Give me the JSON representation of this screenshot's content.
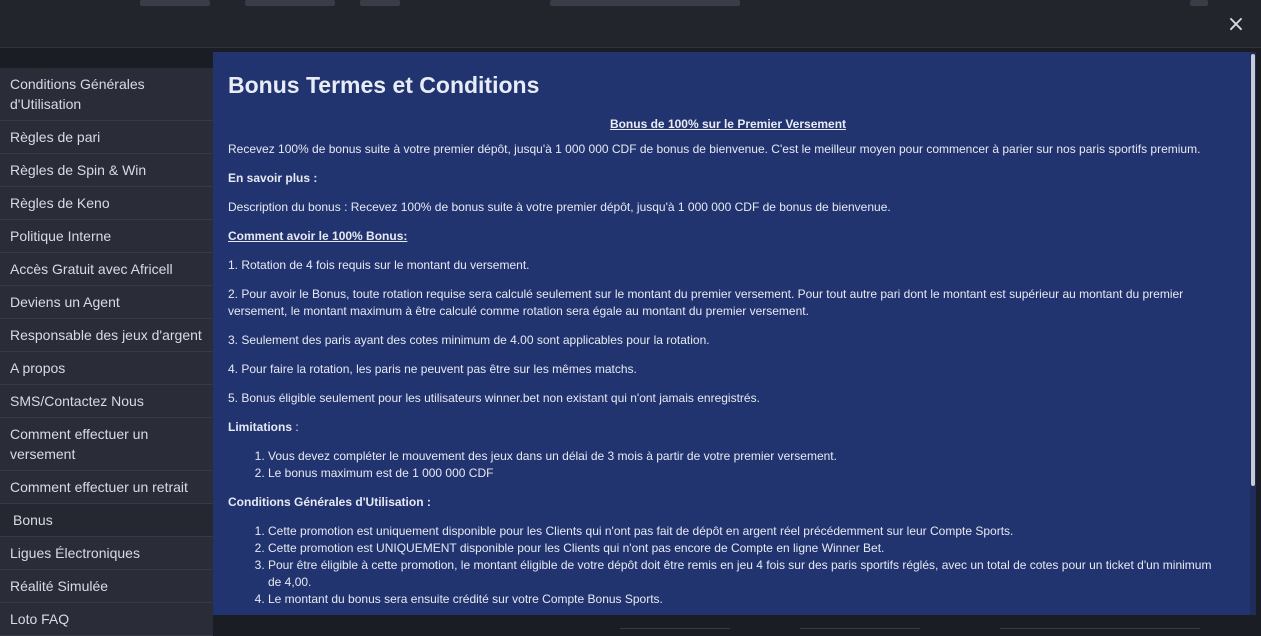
{
  "modal": {
    "close_icon": "×"
  },
  "sidebar": {
    "items": [
      {
        "label": "Conditions Générales d'Utilisation"
      },
      {
        "label": "Règles de pari"
      },
      {
        "label": "Règles de Spin & Win"
      },
      {
        "label": "Règles de Keno"
      },
      {
        "label": "Politique Interne"
      },
      {
        "label": "Accès Gratuit avec Africell"
      },
      {
        "label": "Deviens un Agent"
      },
      {
        "label": "Responsable des jeux d'argent"
      },
      {
        "label": "A propos"
      },
      {
        "label": "SMS/Contactez Nous"
      },
      {
        "label": "Comment effectuer un versement"
      },
      {
        "label": "Comment effectuer un retrait"
      },
      {
        "label": "Bonus"
      },
      {
        "label": "Ligues Électroniques"
      },
      {
        "label": "Réalité Simulée"
      },
      {
        "label": "Loto FAQ"
      }
    ]
  },
  "content": {
    "title": "Bonus Termes et Conditions",
    "subtitle": "Bonus de 100% sur le Premier Versement",
    "intro": "Recevez 100% de bonus suite à votre premier dépôt, jusqu'à 1 000 000 CDF de bonus de bienvenue. C'est le meilleur moyen pour commencer à parier sur nos paris sportifs premium.",
    "learn_more": "En savoir plus :",
    "description": "Description du bonus : Recevez 100% de bonus suite à votre premier dépôt, jusqu'à 1 000 000 CDF de bonus de bienvenue.",
    "how_to": "Comment avoir le 100% Bonus:",
    "steps": [
      "1. Rotation de 4 fois requis sur le montant du versement.",
      "2. Pour avoir le Bonus, toute rotation requise sera calculé seulement sur le montant du premier versement. Pour tout autre pari dont le montant est supérieur au montant du premier versement, le montant maximum à être calculé comme rotation sera égale au montant du premier versement.",
      "3. Seulement des paris ayant des cotes minimum de 4.00 sont applicables pour la rotation.",
      "4. Pour faire la rotation, les paris ne peuvent pas être sur les mêmes matchs.",
      "5. Bonus éligible seulement pour les utilisateurs winner.bet non existant qui n'ont jamais enregistrés."
    ],
    "limitations_label": "Limitations",
    "limitations_colon": " :",
    "limitations": [
      "Vous devez compléter le mouvement des jeux dans un délai de 3 mois à partir de votre premier versement.",
      "Le bonus maximum est de 1 000 000 CDF"
    ],
    "conditions_label": "Conditions Générales d'Utilisation :",
    "conditions": [
      "Cette promotion est uniquement disponible pour les Clients qui n'ont pas fait de dépôt en argent réel précédemment sur leur Compte Sports.",
      "Cette promotion est UNIQUEMENT disponible pour les Clients qui n'ont pas encore de Compte en ligne Winner Bet.",
      "Pour être éligible à cette promotion, le montant éligible de votre dépôt doit être remis en jeu 4 fois sur des paris sportifs réglés, avec un total de cotes pour un ticket d'un minimum de 4,00.",
      "Le montant du bonus sera ensuite crédité sur votre Compte Bonus Sports."
    ]
  },
  "colors": {
    "panel": "#22346f",
    "sidebar": "#2a2d37",
    "background": "#1b1d24"
  }
}
